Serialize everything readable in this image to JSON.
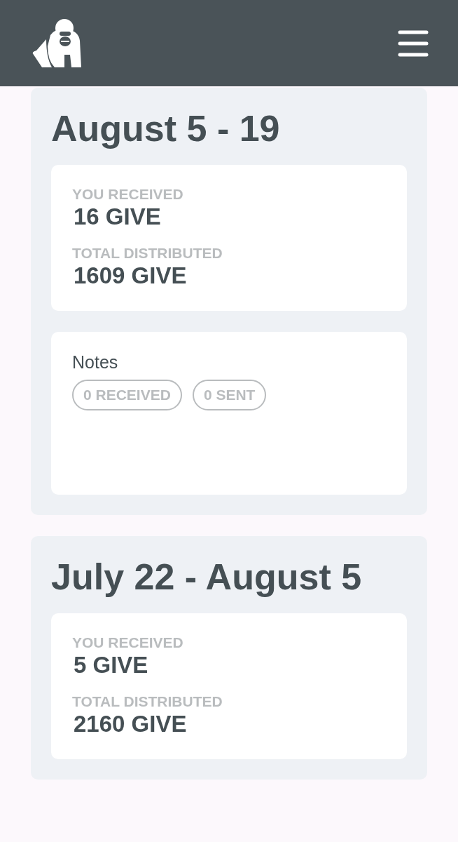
{
  "periods": [
    {
      "title": "August 5 - 19",
      "stats": [
        {
          "label": "YOU RECEIVED",
          "value": "16 GIVE"
        },
        {
          "label": "TOTAL DISTRIBUTED",
          "value": "1609 GIVE"
        }
      ],
      "notes": {
        "title": "Notes",
        "tags": [
          "0 RECEIVED",
          "0 SENT"
        ]
      }
    },
    {
      "title": "July 22 - August 5",
      "stats": [
        {
          "label": "YOU RECEIVED",
          "value": "5 GIVE"
        },
        {
          "label": "TOTAL DISTRIBUTED",
          "value": "2160 GIVE"
        }
      ]
    }
  ]
}
